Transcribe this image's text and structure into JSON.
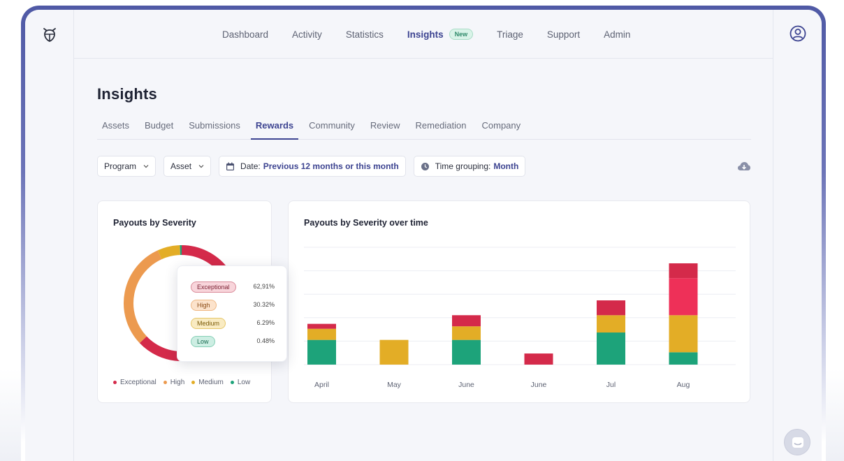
{
  "nav": {
    "items": [
      "Dashboard",
      "Activity",
      "Statistics",
      "Insights",
      "Triage",
      "Support",
      "Admin"
    ],
    "active": "Insights",
    "badge": "New"
  },
  "page": {
    "title": "Insights"
  },
  "subtabs": {
    "items": [
      "Assets",
      "Budget",
      "Submissions",
      "Rewards",
      "Community",
      "Review",
      "Remediation",
      "Company"
    ],
    "active": "Rewards"
  },
  "filters": {
    "program": "Program",
    "asset": "Asset",
    "date_label": "Date:",
    "date_value": "Previous 12 months or this month",
    "grouping_label": "Time grouping:",
    "grouping_value": "Month"
  },
  "donut": {
    "title": "Payouts by Severity",
    "legend": [
      "Exceptional",
      "High",
      "Medium",
      "Low"
    ],
    "tooltip": [
      {
        "label": "Exceptional",
        "value": "62,91%"
      },
      {
        "label": "High",
        "value": "30.32%"
      },
      {
        "label": "Medium",
        "value": "6.29%"
      },
      {
        "label": "Low",
        "value": "0.48%"
      }
    ]
  },
  "colors": {
    "exceptional": "#d42a4a",
    "high": "#ec9a4f",
    "medium": "#e3ad26",
    "low": "#1da37a",
    "exceptional_bright": "#ee3058",
    "accent": "#3d4491"
  },
  "chart_data": [
    {
      "type": "pie",
      "title": "Payouts by Severity",
      "categories": [
        "Exceptional",
        "High",
        "Medium",
        "Low"
      ],
      "values": [
        62.91,
        30.32,
        6.29,
        0.48
      ]
    },
    {
      "type": "bar",
      "title": "Payouts by Severity over time",
      "categories": [
        "April",
        "May",
        "June",
        "June",
        "Jul",
        "Aug"
      ],
      "ylim": [
        0,
        9.5
      ],
      "grid": true,
      "series": [
        {
          "name": "Low",
          "values": [
            2,
            0,
            2,
            0,
            2.6,
            1
          ]
        },
        {
          "name": "Medium",
          "values": [
            0.9,
            2,
            1.1,
            0,
            1.4,
            3
          ]
        },
        {
          "name": "High",
          "values": [
            0,
            0,
            0,
            0,
            0,
            3
          ]
        },
        {
          "name": "Exceptional",
          "values": [
            0.4,
            0,
            0.9,
            0.9,
            1.2,
            1.2
          ]
        }
      ]
    }
  ]
}
